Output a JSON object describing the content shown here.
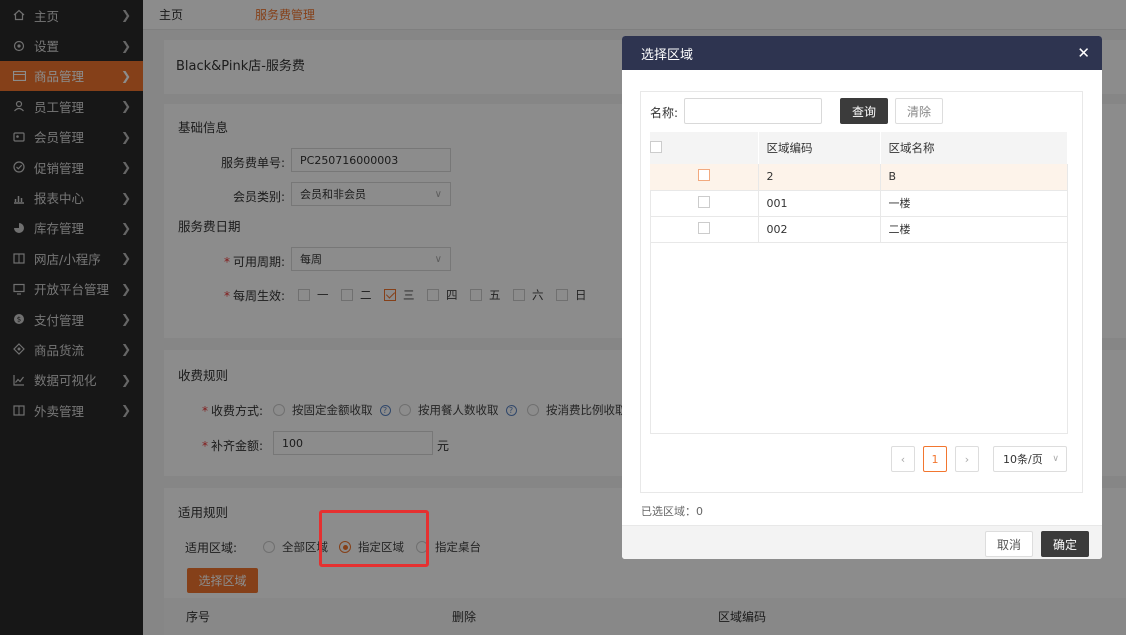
{
  "sidebar": {
    "items": [
      {
        "label": "主页",
        "icon": "home-icon"
      },
      {
        "label": "设置",
        "icon": "gear-icon"
      },
      {
        "label": "商品管理",
        "icon": "goods-icon",
        "active": true
      },
      {
        "label": "员工管理",
        "icon": "staff-icon"
      },
      {
        "label": "会员管理",
        "icon": "member-icon"
      },
      {
        "label": "促销管理",
        "icon": "promo-icon"
      },
      {
        "label": "报表中心",
        "icon": "report-icon"
      },
      {
        "label": "库存管理",
        "icon": "stock-icon"
      },
      {
        "label": "网店/小程序",
        "icon": "shop-icon"
      },
      {
        "label": "开放平台管理",
        "icon": "platform-icon"
      },
      {
        "label": "支付管理",
        "icon": "pay-icon"
      },
      {
        "label": "商品货流",
        "icon": "flow-icon"
      },
      {
        "label": "数据可视化",
        "icon": "chart-icon"
      },
      {
        "label": "外卖管理",
        "icon": "delivery-icon"
      }
    ]
  },
  "breadcrumb": {
    "home": "主页",
    "current": "服务费管理"
  },
  "page": {
    "store_title": "Black&Pink店-服务费"
  },
  "basic": {
    "title": "基础信息",
    "fee_no_label": "服务费单号:",
    "fee_no_value": "PC250716000003",
    "member_type_label": "会员类别:",
    "member_type_value": "会员和非会员"
  },
  "dates": {
    "title": "服务费日期",
    "period_label": "可用周期:",
    "period_value": "每周",
    "weekdays_label": "每周生效:",
    "weekdays": [
      {
        "label": "一",
        "checked": false
      },
      {
        "label": "二",
        "checked": false
      },
      {
        "label": "三",
        "checked": true
      },
      {
        "label": "四",
        "checked": false
      },
      {
        "label": "五",
        "checked": false
      },
      {
        "label": "六",
        "checked": false
      },
      {
        "label": "日",
        "checked": false
      }
    ]
  },
  "charge": {
    "title": "收费规则",
    "method_label": "收费方式:",
    "options": [
      "按固定金额收取",
      "按用餐人数收取",
      "按消费比例收取"
    ],
    "amount_label": "补齐金额:",
    "amount_value": "100",
    "amount_unit": "元"
  },
  "apply": {
    "title": "适用规则",
    "area_label": "适用区域:",
    "options": [
      "全部区域",
      "指定区域",
      "指定桌台"
    ],
    "selected": "指定区域",
    "select_button": "选择区域",
    "columns": [
      "序号",
      "删除",
      "区域编码"
    ]
  },
  "modal": {
    "title": "选择区域",
    "name_label": "名称:",
    "name_value": "",
    "query_button": "查询",
    "clear_button": "清除",
    "columns": [
      "区域编码",
      "区域名称"
    ],
    "rows": [
      {
        "code": "2",
        "name": "B"
      },
      {
        "code": "001",
        "name": "一楼"
      },
      {
        "code": "002",
        "name": "二楼"
      }
    ],
    "page": "1",
    "page_size": "10条/页",
    "selected_count_text": "已选区域：0",
    "cancel_button": "取消",
    "confirm_button": "确定"
  },
  "colors": {
    "accent": "#f2762f",
    "sidebar_bg": "#2a2a2a",
    "modal_header": "#2e3450",
    "annotation": "#e53030"
  }
}
